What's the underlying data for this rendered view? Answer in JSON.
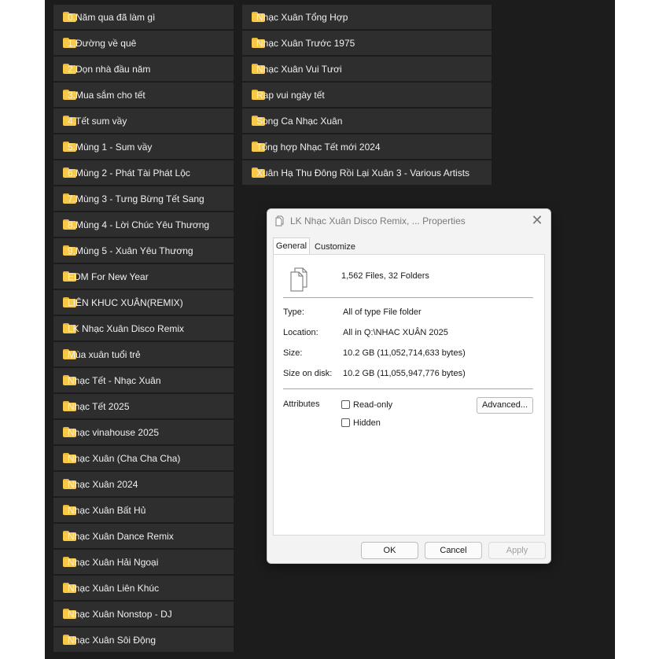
{
  "folders_left": [
    "0.Năm qua đã làm gì",
    "1.Đường về quê",
    "2.Dọn nhà đầu năm",
    "3.Mua sắm cho tết",
    "4.Tết sum vầy",
    "5.Mùng 1 - Sum vầy",
    "6.Mùng 2 - Phát Tài Phát Lộc",
    "7.Mùng 3 - Tưng Bừng Tết Sang",
    "8.Mùng 4 - Lời Chúc Yêu Thương",
    "9.Mùng 5 - Xuân Yêu Thương",
    "EDM For New Year",
    "LIÊN KHUC XUÂN(REMIX)",
    "LK Nhạc Xuân Disco Remix",
    "Mùa xuân tuổi trẻ",
    "Nhạc Tết - Nhạc Xuân",
    "Nhạc Tết 2025",
    "Nhạc vinahouse 2025",
    "Nhạc Xuân (Cha Cha Cha)",
    "Nhạc Xuân 2024",
    "Nhạc Xuân Bất Hủ",
    "Nhạc Xuân Dance Remix",
    "Nhạc Xuân Hải Ngoại",
    "Nhạc Xuân Liên Khúc",
    "Nhạc Xuân Nonstop - DJ",
    "Nhạc Xuân Sôi Động"
  ],
  "folders_right": [
    "Nhạc Xuân Tổng Hợp",
    "Nhạc Xuân Trước 1975",
    "Nhạc Xuân Vui Tươi",
    "Rap vui ngày tết",
    "Song Ca Nhạc Xuân",
    "Tổng hợp Nhạc Tết mới 2024",
    "Xuân Hạ Thu Đông Rồi Lại Xuân 3 - Various Artists"
  ],
  "dialog": {
    "title": "LK Nhạc Xuân Disco Remix, ... Properties",
    "close_glyph": "✕",
    "tabs": {
      "general": "General",
      "customize": "Customize"
    },
    "file_count": "1,562 Files, 32 Folders",
    "type_label": "Type:",
    "type_value": "All of type File folder",
    "location_label": "Location:",
    "location_value": "All in Q:\\NHAC XUÂN 2025",
    "size_label": "Size:",
    "size_value": "10.2 GB (11,052,714,633 bytes)",
    "size_on_disk_label": "Size on disk:",
    "size_on_disk_value": "10.2 GB (11,055,947,776 bytes)",
    "attributes_label": "Attributes",
    "readonly_label": "Read-only",
    "hidden_label": "Hidden",
    "advanced_label": "Advanced...",
    "ok_label": "OK",
    "cancel_label": "Cancel",
    "apply_label": "Apply"
  },
  "colors": {
    "background": "#1c1c1c",
    "folder_tile": "#2e2e2e",
    "folder_icon": "#f7c948"
  },
  "icons": {
    "folder": "folder-icon",
    "properties": "multiple-files-icon",
    "close": "close-icon"
  }
}
